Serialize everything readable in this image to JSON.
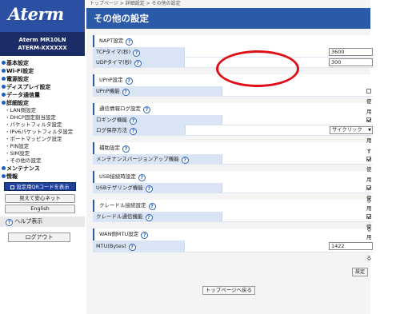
{
  "brand": {
    "logo": "Aterm",
    "model_line1": "Aterm MR10LN",
    "model_line2": "ATERM-XXXXXX"
  },
  "menu": {
    "categories": {
      "basic": "基本設定",
      "wifi": "Wi-Fi設定",
      "power": "電源設定",
      "display": "ディスプレイ設定",
      "data": "データ通信量",
      "detail": "詳細設定",
      "maintenance": "メンテナンス",
      "info": "情報"
    },
    "detail_items": [
      "LAN側設定",
      "DHCP固定割当設定",
      "パケットフィルタ設定",
      "IPv6パケットフィルタ設定",
      "ポートマッピング設定",
      "PIN設定",
      "SIM設定",
      "その他の設定"
    ]
  },
  "sidebar_buttons": {
    "qr": "設定用QRコードを表示",
    "easy_net": "見えて安心ネット",
    "english": "English",
    "help": "ヘルプ表示",
    "logout": "ログアウト"
  },
  "breadcrumb": "トップページ > 詳細設定 > その他の設定",
  "page_title": "その他の設定",
  "sections": {
    "napt": {
      "title": "NAPT設定",
      "tcp_label": "TCPタイマ(秒)",
      "tcp_value": "3600",
      "udp_label": "UDPタイマ(秒)",
      "udp_value": "300"
    },
    "upnp": {
      "title": "UPnP設定",
      "func_label": "UPnP機能",
      "use_label": "使用する",
      "checked": false
    },
    "log": {
      "title": "通信情報ログ設定",
      "logging_label": "ロギング機能",
      "use_label": "使用する",
      "checked": true,
      "method_label": "ログ保存方法",
      "method_value": "サイクリック"
    },
    "aux": {
      "title": "補助設定",
      "maint_label": "メンテナンスバージョンアップ機能",
      "use_label": "使用する",
      "checked": true
    },
    "usb": {
      "title": "USB接続時設定",
      "tether_label": "USBテザリング機能",
      "use_label": "使用する",
      "checked": true
    },
    "cradle": {
      "title": "クレードル接続設定",
      "comm_label": "クレードル通信機能",
      "use_label": "使用する",
      "checked": true
    },
    "wan": {
      "title": "WAN側MTU設定",
      "mtu_label": "MTU(Bytes)",
      "mtu_value": "1422"
    }
  },
  "buttons": {
    "apply": "設定",
    "top_page": "トップページへ戻る"
  },
  "help_icon_text": "?",
  "colors": {
    "header_blue": "#2a4fa3",
    "dark_blue": "#1b2c66",
    "label_bg": "#d9e4f4",
    "highlight_red": "#e0101a"
  }
}
